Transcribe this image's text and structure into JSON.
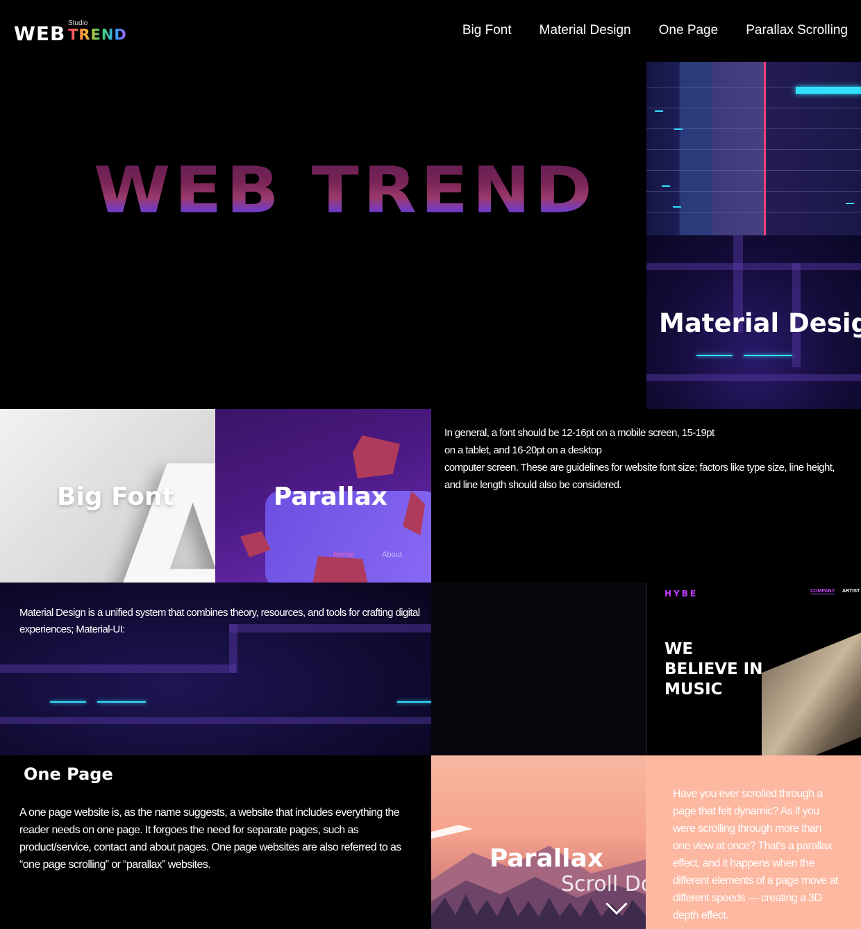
{
  "header": {
    "logo_main": "WEB",
    "logo_small": "Studio",
    "logo_accent": "TREND",
    "nav": [
      "Big Font",
      "Material Design",
      "One Page",
      "Parallax Scrolling"
    ]
  },
  "hero": {
    "title": "WEB TREND"
  },
  "tiles": {
    "material_label": "Material Design",
    "bigfont_label": "Big Font",
    "parallax_label": "Parallax",
    "parallax_tab_home": "Home",
    "parallax_tab_about": "About",
    "sunset_label": "Parallax",
    "sunset_scroll": "Scroll Do"
  },
  "font_paragraph": {
    "line1": "In general, a font should be 12-16pt on a mobile screen, 15-19pt",
    "line2": "on a tablet, and 16-20pt on a desktop",
    "line3": "computer screen. These are guidelines for website font size; factors like type size, line height, and line length should also be considered."
  },
  "material_paragraph": "Material Design is a unified system that combines theory, resources, and tools for crafting digital experiences; Material-UI:",
  "hybe": {
    "logo": "HYBE",
    "nav_company": "COMPANY",
    "nav_artist": "ARTIST",
    "headline_1": "WE",
    "headline_2": "BELIEVE IN",
    "headline_3": "MUSIC"
  },
  "one_page": {
    "title": "One Page",
    "text": "A one page website is, as the name suggests, a website that includes everything the reader needs on one page. It forgoes the need for separate pages, such as product/service, contact and about pages. One page websites are also referred to as “one page scrolling” or “parallax” websites."
  },
  "parallax_paragraph": "Have you ever scrolled through a page that felt dynamic? As if you were scrolling through more than one view at once? That’s a parallax effect, and it happens when the different elements of a page move at different speeds — creating a 3D depth effect.",
  "colors": {
    "accent_purple": "#c13cff",
    "cyan": "#35e0ff",
    "peach": "#fdb8a2"
  }
}
